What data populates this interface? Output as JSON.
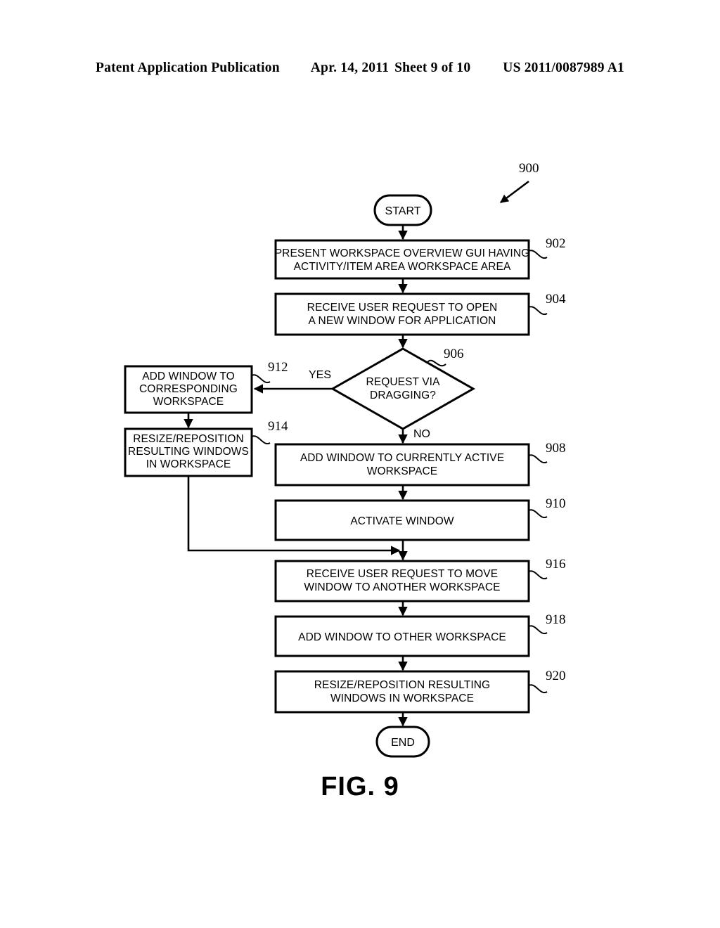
{
  "header": {
    "publication": "Patent Application Publication",
    "date": "Apr. 14, 2011",
    "sheet": "Sheet 9 of 10",
    "patent_number": "US 2011/0087989 A1"
  },
  "figure": {
    "label": "FIG. 9",
    "diagram_ref": "900"
  },
  "flowchart": {
    "start_label": "START",
    "end_label": "END",
    "branch_yes": "YES",
    "branch_no": "NO",
    "nodes": [
      {
        "ref": "902",
        "lines": [
          "PRESENT WORKSPACE OVERVIEW GUI HAVING",
          "ACTIVITY/ITEM AREA WORKSPACE AREA"
        ]
      },
      {
        "ref": "904",
        "lines": [
          "RECEIVE USER REQUEST TO OPEN",
          "A NEW WINDOW FOR APPLICATION"
        ]
      },
      {
        "ref": "906",
        "lines": [
          "REQUEST VIA",
          "DRAGGING?"
        ]
      },
      {
        "ref": "912",
        "lines": [
          "ADD WINDOW TO",
          "CORRESPONDING",
          "WORKSPACE"
        ]
      },
      {
        "ref": "914",
        "lines": [
          "RESIZE/REPOSITION",
          "RESULTING WINDOWS",
          "IN WORKSPACE"
        ]
      },
      {
        "ref": "908",
        "lines": [
          "ADD WINDOW TO CURRENTLY ACTIVE",
          "WORKSPACE"
        ]
      },
      {
        "ref": "910",
        "lines": [
          "ACTIVATE WINDOW"
        ]
      },
      {
        "ref": "916",
        "lines": [
          "RECEIVE USER REQUEST TO MOVE",
          "WINDOW TO ANOTHER WORKSPACE"
        ]
      },
      {
        "ref": "918",
        "lines": [
          "ADD WINDOW TO OTHER WORKSPACE"
        ]
      },
      {
        "ref": "920",
        "lines": [
          "RESIZE/REPOSITION RESULTING",
          "WINDOWS IN WORKSPACE"
        ]
      }
    ]
  }
}
